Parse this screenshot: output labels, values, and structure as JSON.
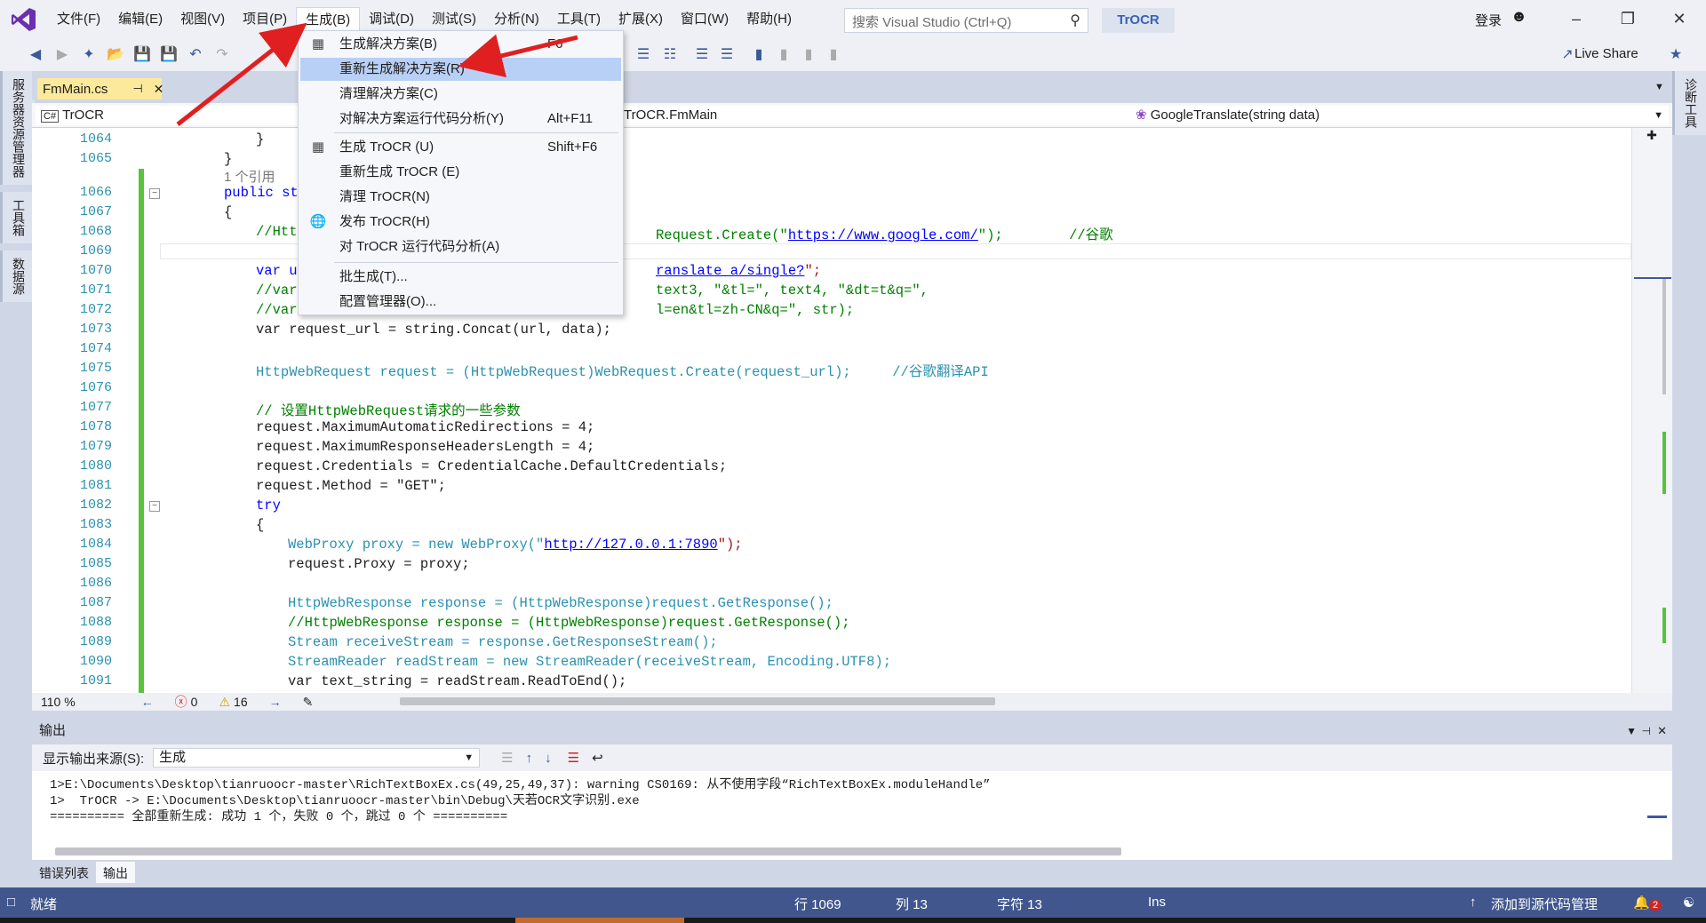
{
  "menubar": {
    "items": [
      "文件(F)",
      "编辑(E)",
      "视图(V)",
      "项目(P)",
      "生成(B)",
      "调试(D)",
      "测试(S)",
      "分析(N)",
      "工具(T)",
      "扩展(X)",
      "窗口(W)",
      "帮助(H)"
    ],
    "search_placeholder": "搜索 Visual Studio (Ctrl+Q)",
    "solution_name": "TrOCR",
    "login": "登录"
  },
  "toolbar": {
    "live_share": "Live Share"
  },
  "side_left": [
    "服务器资源管理器",
    "工具箱",
    "数据源"
  ],
  "side_right": [
    "诊断工具"
  ],
  "doc_tab": {
    "file": "FmMain.cs",
    "pin": "⊣",
    "close": "✕"
  },
  "navbar": {
    "project": "TrOCR",
    "class": "TrOCR.FmMain",
    "member": "GoogleTranslate(string data)"
  },
  "build_menu": {
    "items": [
      {
        "label": "生成解决方案(B)",
        "shortcut": "F6",
        "icon": "build-icon"
      },
      {
        "label": "重新生成解决方案(R)",
        "shortcut": "",
        "icon": ""
      },
      {
        "label": "清理解决方案(C)",
        "shortcut": "",
        "icon": ""
      },
      {
        "label": "对解决方案运行代码分析(Y)",
        "shortcut": "Alt+F11",
        "icon": ""
      },
      {
        "label": "生成 TrOCR (U)",
        "shortcut": "Shift+F6",
        "icon": "build-icon"
      },
      {
        "label": "重新生成 TrOCR (E)",
        "shortcut": "",
        "icon": ""
      },
      {
        "label": "清理 TrOCR(N)",
        "shortcut": "",
        "icon": ""
      },
      {
        "label": "发布 TrOCR(H)",
        "shortcut": "",
        "icon": "globe-icon"
      },
      {
        "label": "对 TrOCR 运行代码分析(A)",
        "shortcut": "",
        "icon": ""
      },
      {
        "label": "批生成(T)...",
        "shortcut": "",
        "icon": ""
      },
      {
        "label": "配置管理器(O)...",
        "shortcut": "",
        "icon": ""
      }
    ]
  },
  "editor": {
    "line_numbers": [
      "1064",
      "1065",
      "",
      "1066",
      "1067",
      "1068",
      "1069",
      "1070",
      "1071",
      "1072",
      "1073",
      "1074",
      "1075",
      "1076",
      "1077",
      "1078",
      "1079",
      "1080",
      "1081",
      "1082",
      "1083",
      "1084",
      "1085",
      "1086",
      "1087",
      "1088",
      "1089",
      "1090",
      "1091"
    ],
    "ref_hint": "1 个引用",
    "code": {
      "l1064": "}",
      "l1065": "}",
      "l1066_kw": "public st",
      "l1067": "{",
      "l1068_a": "//Htt",
      "l1068_b": "Request.Create(\"",
      "l1068_url": "https://www.google.com/",
      "l1068_c": "\");        //谷歌",
      "l1070_a": "var u",
      "l1070_url": "ranslate_a/single?",
      "l1070_b": "\";",
      "l1071_a": "//var",
      "l1071_b": "text3, \"&tl=\", text4, \"&dt=t&q=\",",
      "l1072_a": "//var",
      "l1072_b": "l=en&tl=zh-CN&q=\", str);",
      "l1073": "var request_url = string.Concat(url, data);",
      "l1075": "HttpWebRequest request = (HttpWebRequest)WebRequest.Create(request_url);     //谷歌翻译API",
      "l1077": "// 设置HttpWebRequest请求的一些参数",
      "l1078": "request.MaximumAutomaticRedirections = 4;",
      "l1079": "request.MaximumResponseHeadersLength = 4;",
      "l1080": "request.Credentials = CredentialCache.DefaultCredentials;",
      "l1081": "request.Method = \"GET\";",
      "l1082": "try",
      "l1083": "{",
      "l1084_a": "WebProxy proxy = new WebProxy(\"",
      "l1084_url": "http://127.0.0.1:7890",
      "l1084_b": "\");",
      "l1085": "request.Proxy = proxy;",
      "l1087": "HttpWebResponse response = (HttpWebResponse)request.GetResponse();",
      "l1088": "//HttpWebResponse response = (HttpWebResponse)request.GetResponse();",
      "l1089": "Stream receiveStream = response.GetResponseStream();",
      "l1090": "StreamReader readStream = new StreamReader(receiveStream, Encoding.UTF8);",
      "l1091": "var text_string = readStream.ReadToEnd();"
    }
  },
  "editor_status": {
    "zoom": "110 %",
    "errors": "0",
    "warnings": "16"
  },
  "output": {
    "title": "输出",
    "source_label": "显示输出来源(S):",
    "source_value": "生成",
    "lines": [
      "1>E:\\Documents\\Desktop\\tianruoocr-master\\RichTextBoxEx.cs(49,25,49,37): warning CS0169: 从不使用字段“RichTextBoxEx.moduleHandle”",
      "1>  TrOCR -> E:\\Documents\\Desktop\\tianruoocr-master\\bin\\Debug\\天若OCR文字识别.exe",
      "========== 全部重新生成: 成功 1 个，失败 0 个，跳过 0 个 =========="
    ],
    "tabs": [
      "错误列表",
      "输出"
    ]
  },
  "statusbar": {
    "ready": "就绪",
    "line": "行 1069",
    "col": "列 13",
    "char": "字符 13",
    "ins": "Ins",
    "source_control": "添加到源代码管理",
    "notifications": "2"
  },
  "colors": {
    "accent": "#40568d",
    "arrow": "#e02020",
    "highlight": "#b9d0f6"
  }
}
